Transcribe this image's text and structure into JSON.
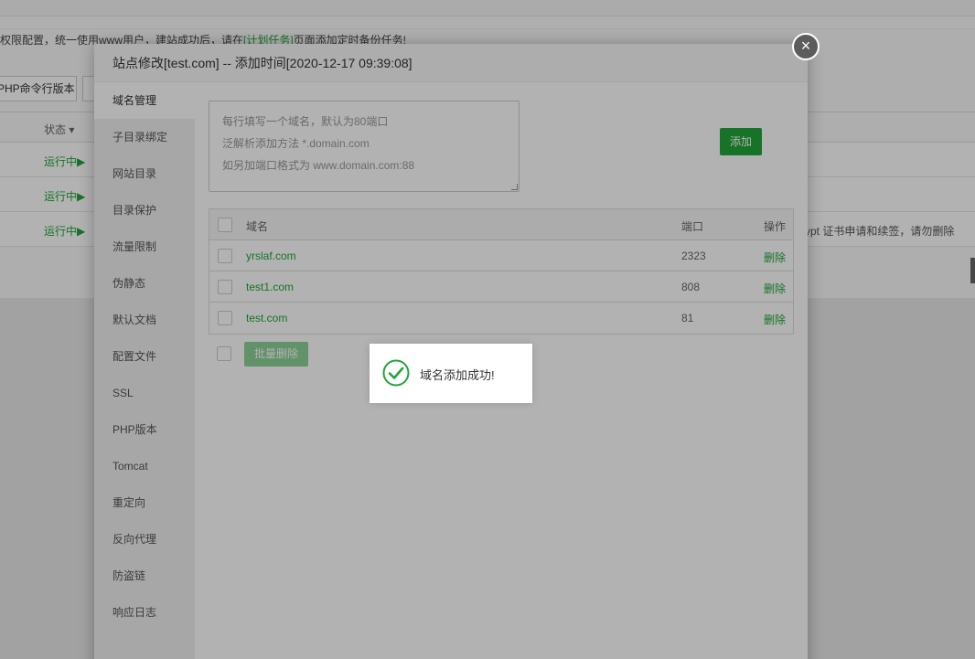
{
  "background": {
    "notice_prefix": "权限配置，统一使用www用户，建站成功后，请在",
    "notice_link": "[计划任务]",
    "notice_suffix": "页面添加定时备份任务!",
    "php_cli_button": "PHP命令行版本",
    "status_header": "状态 ▾",
    "rows": [
      {
        "status": "运行中▶",
        "note": ""
      },
      {
        "status": "运行中▶",
        "note": ""
      },
      {
        "status": "运行中▶",
        "note": "ypt 证书申请和续签，请勿删除"
      }
    ]
  },
  "modal": {
    "title": "站点修改[test.com] -- 添加时间[2020-12-17 09:39:08]",
    "close_glyph": "×",
    "sidebar": [
      "域名管理",
      "子目录绑定",
      "网站目录",
      "目录保护",
      "流量限制",
      "伪静态",
      "默认文档",
      "配置文件",
      "SSL",
      "PHP版本",
      "Tomcat",
      "重定向",
      "反向代理",
      "防盗链",
      "响应日志"
    ],
    "input": {
      "placeholder_lines": [
        "每行填写一个域名，默认为80端口",
        "泛解析添加方法 *.domain.com",
        "如另加端口格式为 www.domain.com:88"
      ]
    },
    "add_button": "添加",
    "table": {
      "headers": {
        "name": "域名",
        "port": "端口",
        "op": "操作"
      },
      "rows": [
        {
          "name": "yrslaf.com",
          "port": "2323",
          "op": "删除"
        },
        {
          "name": "test1.com",
          "port": "808",
          "op": "删除"
        },
        {
          "name": "test.com",
          "port": "81",
          "op": "删除"
        }
      ]
    },
    "batch_delete": "批量删除"
  },
  "toast": {
    "message": "域名添加成功!",
    "icon": "check-circle-icon",
    "icon_color": "#20a53a"
  },
  "colors": {
    "accent": "#20a53a"
  }
}
